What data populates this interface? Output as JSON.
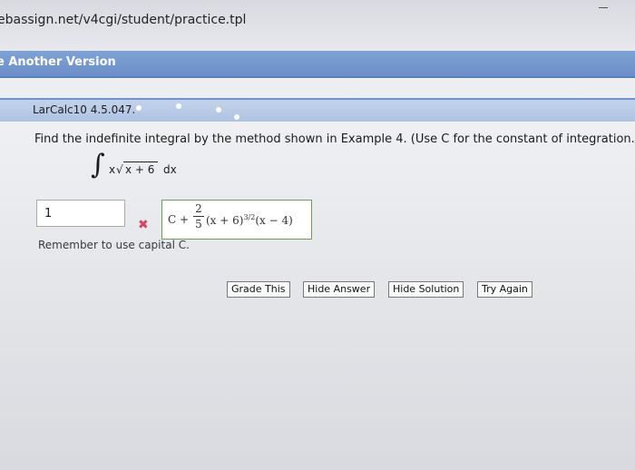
{
  "browser": {
    "url": "ebassign.net/v4cgi/student/practice.tpl"
  },
  "toolbar": {
    "another_version": "e Another Version"
  },
  "question": {
    "id": "LarCalc10 4.5.047.",
    "prompt": "Find the indefinite integral by the method shown in Example 4. (Use C for the constant of integration.)",
    "integral": {
      "sign": "∫",
      "factor": "x",
      "radicand": "x + 6",
      "differential": "dx"
    }
  },
  "answer": {
    "value": "1",
    "status_icon": "x-mark-icon",
    "correct": {
      "prefix": "C + ",
      "numerator": "2",
      "denominator": "5",
      "body": "(x + 6)",
      "exponent": "3/2",
      "suffix": "(x − 4)"
    },
    "hint": "Remember to use capital C."
  },
  "buttons": {
    "grade": "Grade This",
    "hide_answer": "Hide Answer",
    "hide_solution": "Hide Solution",
    "try_again": "Try Again"
  },
  "colors": {
    "accent_bar": "#6b8fc8",
    "question_header": "#b9cbe6",
    "wrong": "#d6455f",
    "correct_border": "#6d9b58"
  }
}
